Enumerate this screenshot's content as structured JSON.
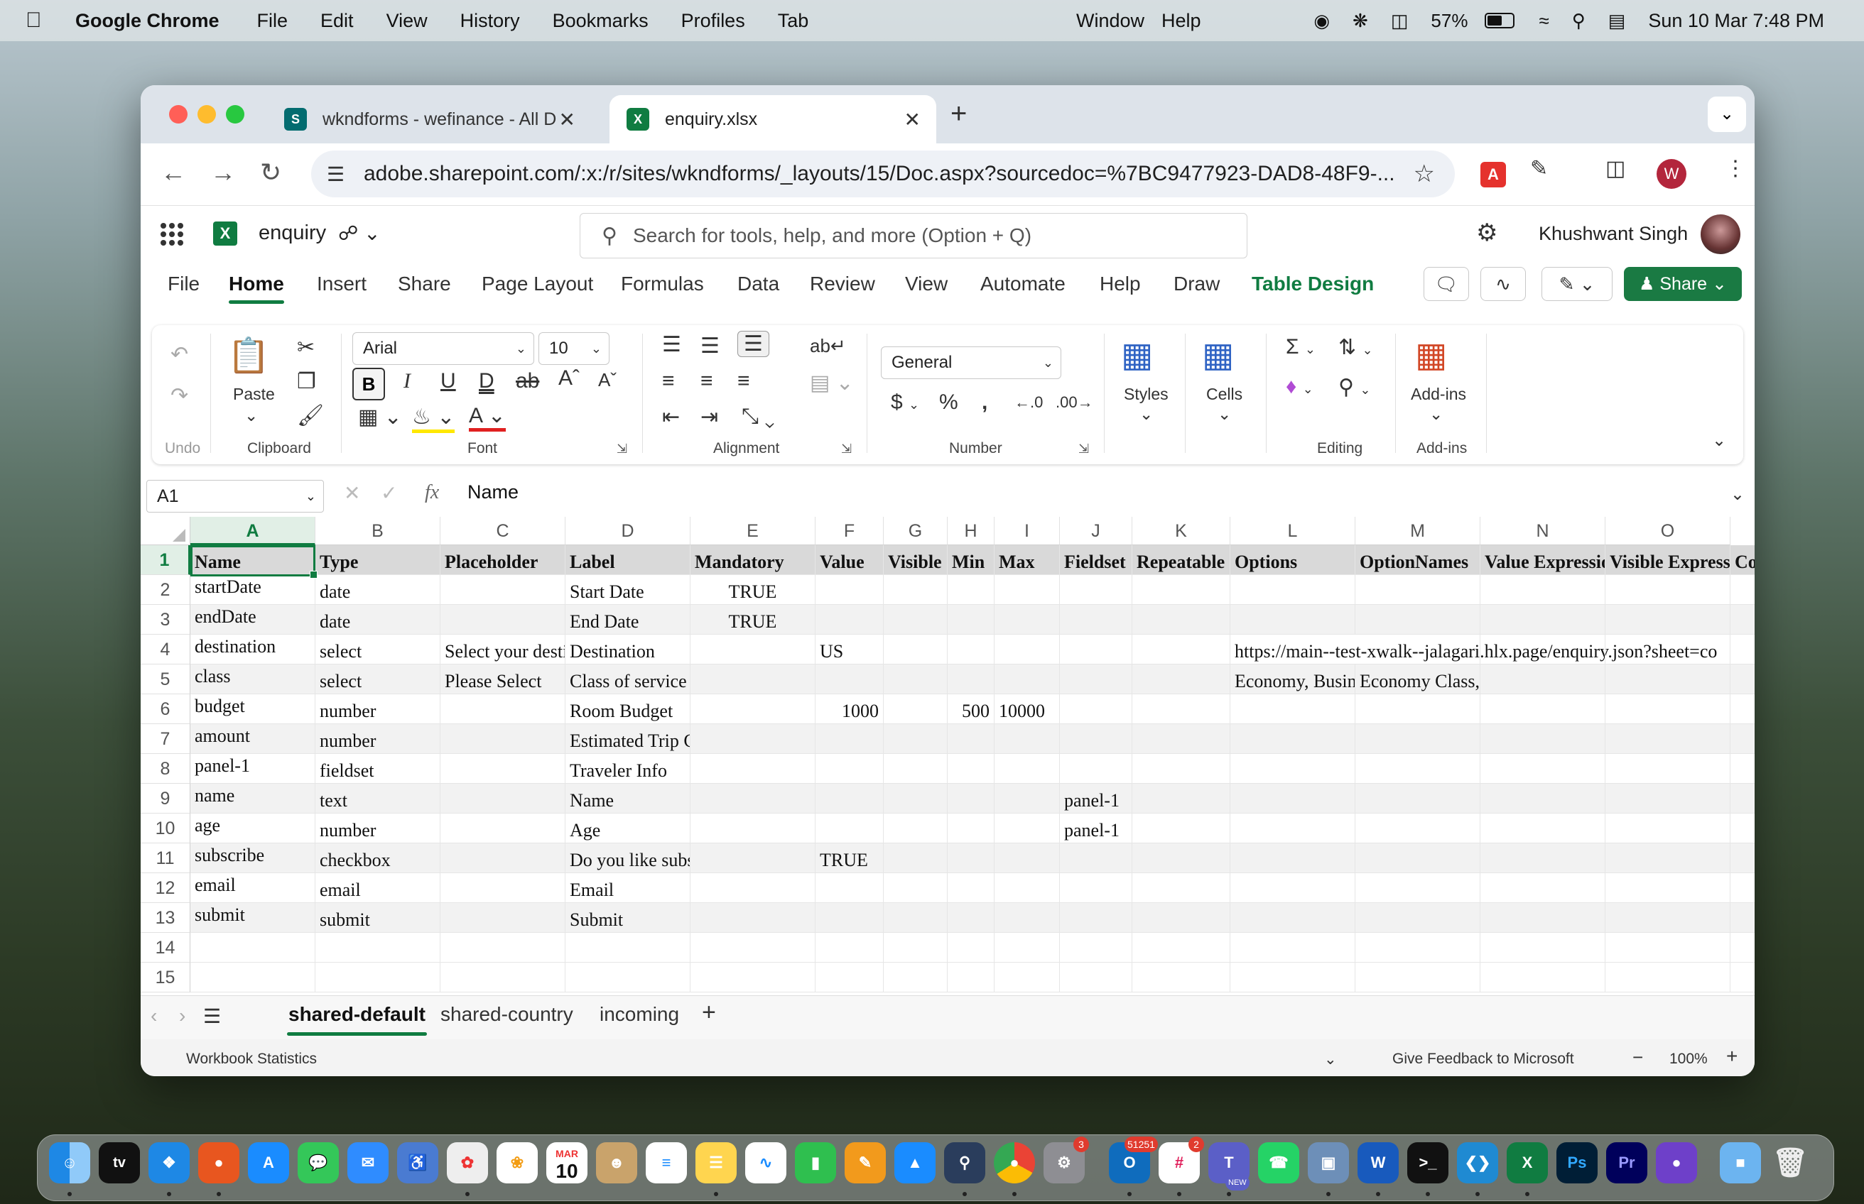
{
  "menubar": {
    "app_name": "Google Chrome",
    "items": [
      "File",
      "Edit",
      "View",
      "History",
      "Bookmarks",
      "Profiles",
      "Tab"
    ],
    "right_items": [
      "Window",
      "Help"
    ],
    "battery": "57%",
    "datetime": "Sun 10 Mar  7:48 PM"
  },
  "browser": {
    "tabs": [
      {
        "title": "wkndforms - wefinance - All D",
        "favicon": "sharepoint-icon",
        "color": "#036c70"
      },
      {
        "title": "enquiry.xlsx",
        "favicon": "excel-icon",
        "color": "#107c41"
      }
    ],
    "url": "adobe.sharepoint.com/:x:/r/sites/wkndforms/_layouts/15/Doc.aspx?sourcedoc=%7BC9477923-DAD8-48F9-...",
    "profile_initial": "W"
  },
  "excel": {
    "doc_name": "enquiry",
    "search_placeholder": "Search for tools, help, and more (Option + Q)",
    "user_name": "Khushwant Singh",
    "ribbon_tabs": [
      "File",
      "Home",
      "Insert",
      "Share",
      "Page Layout",
      "Formulas",
      "Data",
      "Review",
      "View",
      "Automate",
      "Help",
      "Draw",
      "Table Design"
    ],
    "active_tab": "Home",
    "share_label": "Share",
    "groups": {
      "undo": "Undo",
      "clipboard": "Clipboard",
      "font": "Font",
      "alignment": "Alignment",
      "number": "Number",
      "editing": "Editing",
      "addins": "Add-ins"
    },
    "paste_label": "Paste",
    "font_name": "Arial",
    "font_size": "10",
    "number_format": "General",
    "styles_label": "Styles",
    "cells_label": "Cells",
    "addins_label": "Add-ins",
    "namebox": "A1",
    "formula": "Name"
  },
  "grid": {
    "columns": [
      "A",
      "B",
      "C",
      "D",
      "E",
      "F",
      "G",
      "H",
      "I",
      "J",
      "K",
      "L",
      "M",
      "N",
      "O"
    ],
    "rows": [
      [
        "Name",
        "Type",
        "Placeholder",
        "Label",
        "Mandatory",
        "Value",
        "Visible",
        "Min",
        "Max",
        "Fieldset",
        "Repeatable",
        "Options",
        "OptionNames",
        "Value Expression",
        "Visible Expression",
        "Co"
      ],
      [
        "startDate",
        "date",
        "",
        "Start Date",
        "TRUE",
        "",
        "",
        "",
        "",
        "",
        "",
        "",
        "",
        "",
        "",
        ""
      ],
      [
        "endDate",
        "date",
        "",
        "End Date",
        "TRUE",
        "",
        "",
        "",
        "",
        "",
        "",
        "",
        "",
        "",
        "",
        ""
      ],
      [
        "destination",
        "select",
        "Select your destination",
        "Destination",
        "",
        "US",
        "",
        "",
        "",
        "",
        "",
        "https://main--test-xwalk--jalagari.hlx.page/enquiry.json?sheet=co",
        "",
        "",
        "",
        ""
      ],
      [
        "class",
        "select",
        "Please Select",
        "Class of service",
        "",
        "",
        "",
        "",
        "",
        "",
        "",
        "Economy, Business, First",
        "Economy Class, Business Class, First Class",
        "",
        "",
        ""
      ],
      [
        "budget",
        "number",
        "",
        "Room Budget",
        "",
        "1000",
        "",
        "500",
        "10000",
        "",
        "",
        "",
        "",
        "",
        "",
        ""
      ],
      [
        "amount",
        "number",
        "",
        "Estimated Trip Cost",
        "",
        "",
        "",
        "",
        "",
        "",
        "",
        "",
        "",
        "",
        "",
        ""
      ],
      [
        "panel-1",
        "fieldset",
        "",
        "Traveler Info",
        "",
        "",
        "",
        "",
        "",
        "",
        "",
        "",
        "",
        "",
        "",
        ""
      ],
      [
        "name",
        "text",
        "",
        "Name",
        "",
        "",
        "",
        "",
        "",
        "panel-1",
        "",
        "",
        "",
        "",
        "",
        ""
      ],
      [
        "age",
        "number",
        "",
        "Age",
        "",
        "",
        "",
        "",
        "",
        "panel-1",
        "",
        "",
        "",
        "",
        "",
        ""
      ],
      [
        "subscribe",
        "checkbox",
        "",
        "Do you like subscribe for Magazine",
        "",
        "TRUE",
        "",
        "",
        "",
        "",
        "",
        "",
        "",
        "",
        "",
        ""
      ],
      [
        "email",
        "email",
        "",
        "Email",
        "",
        "",
        "",
        "",
        "",
        "",
        "",
        "",
        "",
        "",
        "",
        ""
      ],
      [
        "submit",
        "submit",
        "",
        "Submit",
        "",
        "",
        "",
        "",
        "",
        "",
        "",
        "",
        "",
        "",
        "",
        ""
      ],
      [
        "",
        "",
        "",
        "",
        "",
        "",
        "",
        "",
        "",
        "",
        "",
        "",
        "",
        "",
        "",
        ""
      ],
      [
        "",
        "",
        "",
        "",
        "",
        "",
        "",
        "",
        "",
        "",
        "",
        "",
        "",
        "",
        "",
        ""
      ]
    ],
    "row_numbers": [
      "1",
      "2",
      "3",
      "4",
      "5",
      "6",
      "7",
      "8",
      "9",
      "10",
      "11",
      "12",
      "13",
      "14",
      "15"
    ]
  },
  "sheets": [
    "shared-default",
    "shared-country",
    "incoming"
  ],
  "active_sheet": "shared-default",
  "status": {
    "left": "Workbook Statistics",
    "feedback": "Give Feedback to Microsoft",
    "zoom": "100%"
  },
  "dock": {
    "calendar_month": "MAR",
    "calendar_day": "10",
    "badges": {
      "settings": "3",
      "outlook": "51251",
      "slack": "2"
    },
    "teams_label": "NEW"
  }
}
